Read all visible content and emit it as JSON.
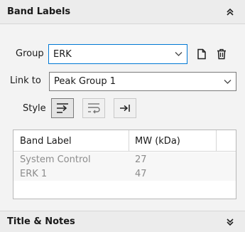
{
  "band_labels": {
    "header": "Band Labels",
    "group_label": "Group",
    "group_value": "ERK",
    "link_label": "Link to",
    "link_value": "Peak Group 1",
    "style_label": "Style",
    "style_buttons": [
      "wrap-arrow-icon",
      "wrap-lines-icon",
      "tab-stop-icon"
    ],
    "table": {
      "columns": [
        "Band Label",
        "MW (kDa)"
      ],
      "rows": [
        {
          "label": "System Control",
          "mw": "27"
        },
        {
          "label": "ERK 1",
          "mw": "47"
        }
      ]
    }
  },
  "title_notes": {
    "header": "Title & Notes"
  },
  "colors": {
    "focus_border": "#0078d4",
    "muted_text": "#8c8c8c"
  }
}
